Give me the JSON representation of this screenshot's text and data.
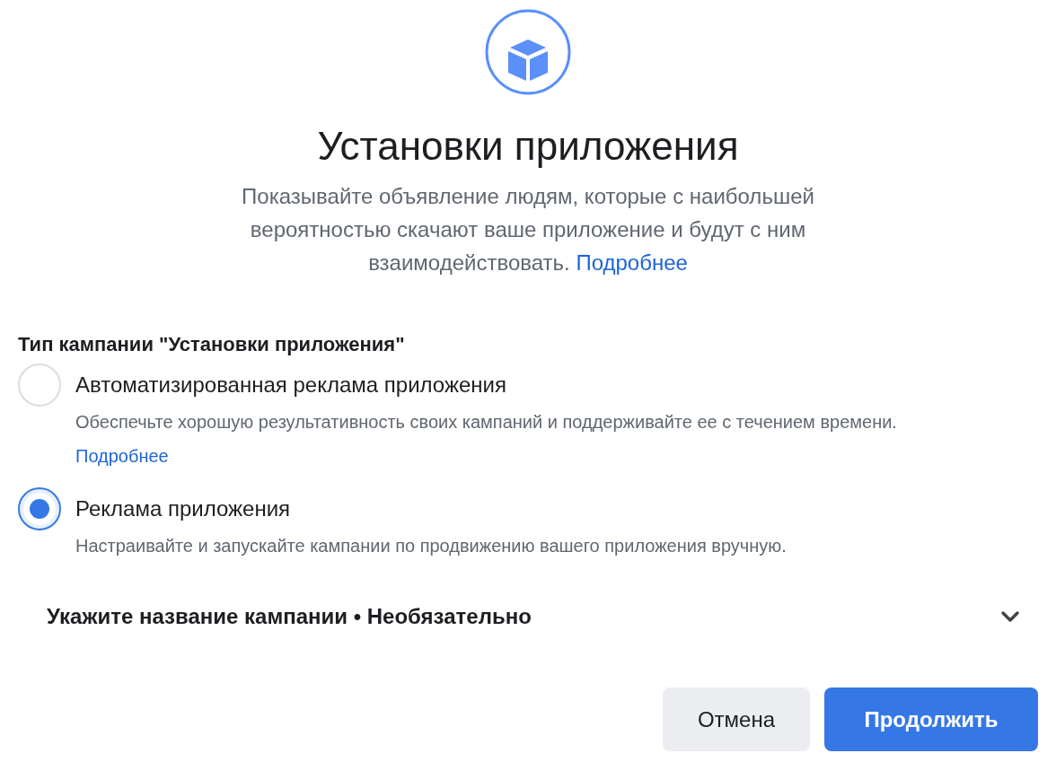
{
  "header": {
    "title": "Установки приложения",
    "description": "Показывайте объявление людям, которые с наибольшей вероятностью скачают ваше приложение и будут с ним взаимодействовать.",
    "link": "Подробнее"
  },
  "campaign_type": {
    "label": "Тип кампании \"Установки приложения\"",
    "options": [
      {
        "title": "Автоматизированная реклама приложения",
        "description": "Обеспечьте хорошую результативность своих кампаний и поддерживайте ее с течением времени.",
        "link": "Подробнее",
        "selected": false
      },
      {
        "title": "Реклама приложения",
        "description": "Настраивайте и запускайте кампании по продвижению вашего приложения вручную.",
        "selected": true
      }
    ]
  },
  "name_section": {
    "label": "Укажите название кампании • Необязательно",
    "expanded": false
  },
  "buttons": [
    {
      "label": "Отмена",
      "kind": "secondary"
    },
    {
      "label": "Продолжить",
      "kind": "primary"
    }
  ]
}
